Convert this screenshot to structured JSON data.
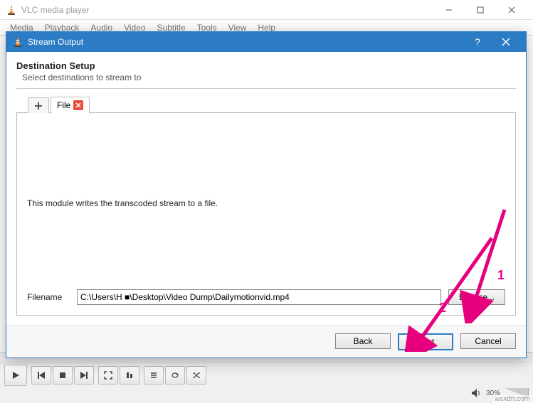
{
  "main": {
    "title": "VLC media player",
    "menu": [
      "Media",
      "Playback",
      "Audio",
      "Video",
      "Subtitle",
      "Tools",
      "View",
      "Help"
    ]
  },
  "dialog": {
    "title": "Stream Output",
    "header": "Destination Setup",
    "subheader": "Select destinations to stream to",
    "tab_label": "File",
    "module_text": "This module writes the transcoded stream to a file.",
    "filename_label": "Filename",
    "filename_value": "C:\\Users\\H ■\\Desktop\\Video Dump\\Dailymotionvid.mp4",
    "browse_label": "Browse...",
    "buttons": {
      "back": "Back",
      "next": "Next",
      "cancel": "Cancel"
    }
  },
  "annotations": {
    "one": "1",
    "two": "2"
  },
  "status": {
    "volume": "30%"
  },
  "watermark": "wsxdn.com"
}
